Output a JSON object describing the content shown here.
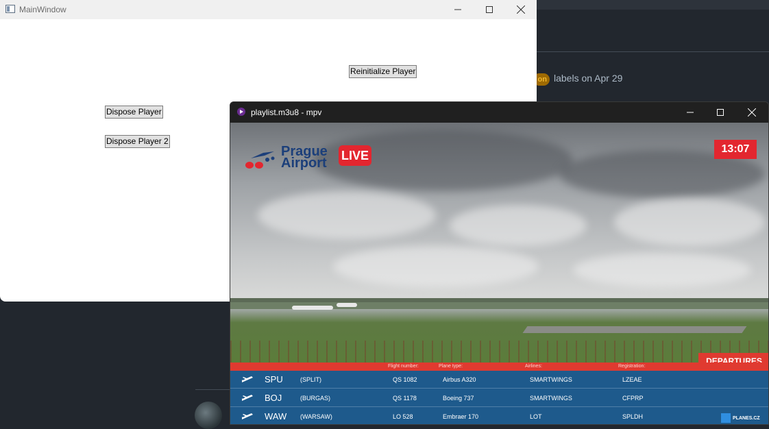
{
  "background": {
    "activity_text": "labels on Apr 29",
    "badge_text": "on"
  },
  "main_window": {
    "title": "MainWindow",
    "buttons": {
      "reinitialize": "Reinitialize Player",
      "dispose": "Dispose Player",
      "dispose2": "Dispose Player 2"
    }
  },
  "mpv_window": {
    "title": "playlist.m3u8 - mpv",
    "video": {
      "logo_line1": "Prague",
      "logo_line2": "Airport",
      "live_label": "LIVE",
      "clock": "13:07",
      "departures_label": "DEPARTURES",
      "board_headers": [
        "Flight number:",
        "Plane type:",
        "Airlines:",
        "Registration:"
      ],
      "flights": [
        {
          "code": "SPU",
          "city": "(SPLIT)",
          "flight": "QS 1082",
          "plane": "Airbus A320",
          "airline": "SMARTWINGS",
          "reg": "LZEAE"
        },
        {
          "code": "BOJ",
          "city": "(BURGAS)",
          "flight": "QS 1178",
          "plane": "Boeing 737",
          "airline": "SMARTWINGS",
          "reg": "CFPRP"
        },
        {
          "code": "WAW",
          "city": "(WARSAW)",
          "flight": "LO 528",
          "plane": "Embraer 170",
          "airline": "LOT",
          "reg": "SPLDH"
        }
      ],
      "watermark": "PLANES.CZ"
    }
  },
  "colors": {
    "live_red": "#e3262f",
    "board_blue": "#1e5a8c",
    "logo_blue": "#1c3f7a"
  }
}
